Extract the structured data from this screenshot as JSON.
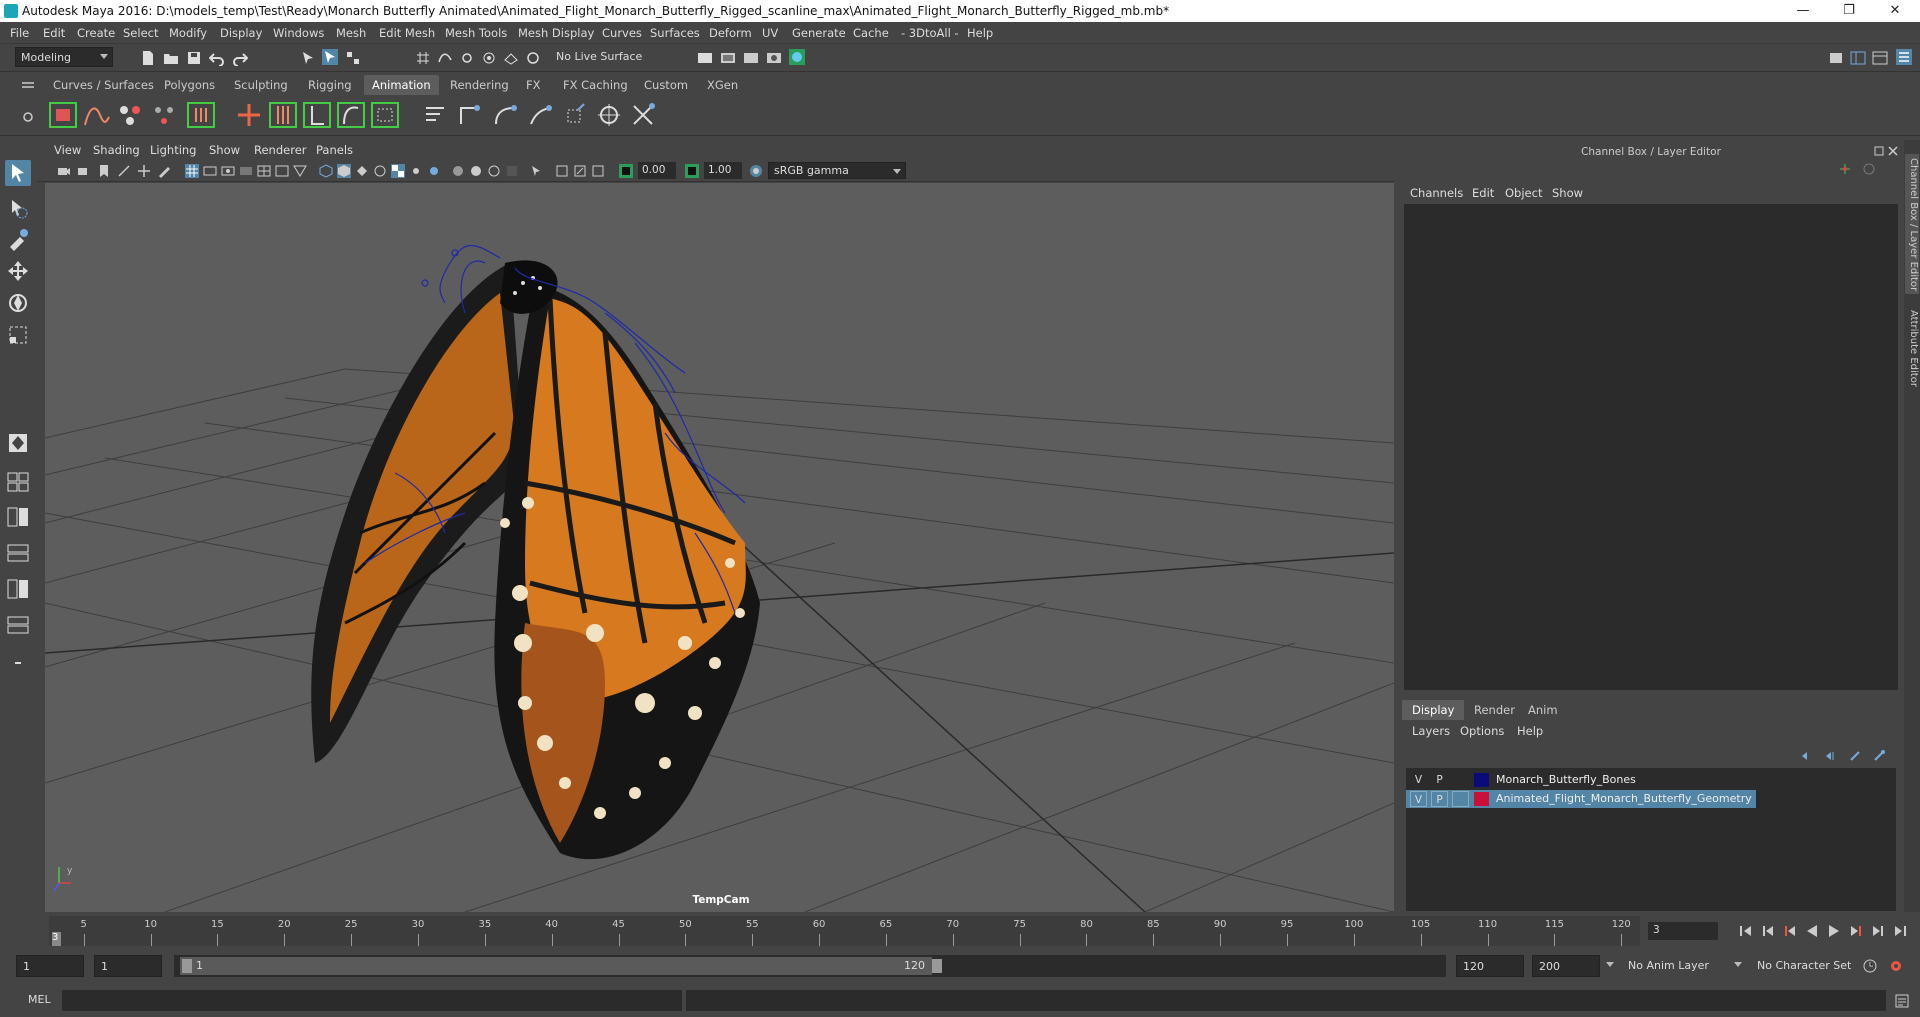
{
  "window": {
    "title": "Autodesk Maya 2016: D:\\models_temp\\Test\\Ready\\Monarch Butterfly Animated\\Animated_Flight_Monarch_Butterfly_Rigged_scanline_max\\Animated_Flight_Monarch_Butterfly_Rigged_mb.mb*",
    "minimize": "—",
    "restore": "❐",
    "close": "✕"
  },
  "menubar": [
    "File",
    "Edit",
    "Create",
    "Select",
    "Modify",
    "Display",
    "Windows",
    "Mesh",
    "Edit Mesh",
    "Mesh Tools",
    "Mesh Display",
    "Curves",
    "Surfaces",
    "Deform",
    "UV",
    "Generate",
    "Cache",
    "- 3DtoAll -",
    "Help"
  ],
  "statusline": {
    "mode": "Modeling",
    "live_surface": "No Live Surface"
  },
  "shelf_tabs": [
    "Curves / Surfaces",
    "Polygons",
    "Sculpting",
    "Rigging",
    "Animation",
    "Rendering",
    "FX",
    "FX Caching",
    "Custom",
    "XGen"
  ],
  "shelf_active": "Animation",
  "viewport": {
    "menu": [
      "View",
      "Shading",
      "Lighting",
      "Show",
      "Renderer",
      "Panels"
    ],
    "exposure": "0.00",
    "gamma": "1.00",
    "colorspace": "sRGB gamma",
    "camera": "TempCam"
  },
  "channelbox": {
    "header": "Channel Box / Layer Editor",
    "menu": [
      "Channels",
      "Edit",
      "Object",
      "Show"
    ]
  },
  "layer_editor": {
    "tabs": [
      "Display",
      "Render",
      "Anim"
    ],
    "active_tab": "Display",
    "menu": [
      "Layers",
      "Options",
      "Help"
    ],
    "layers": [
      {
        "v": "V",
        "p": "P",
        "color": "#0a0a7a",
        "name": "Monarch_Butterfly_Bones",
        "selected": false
      },
      {
        "v": "V",
        "p": "P",
        "color": "#c8103a",
        "name": "Animated_Flight_Monarch_Butterfly_Geometry",
        "selected": true
      }
    ]
  },
  "dock_tabs": [
    "Channel Box / Layer Editor",
    "Attribute Editor"
  ],
  "timeslider": {
    "ticks": [
      "5",
      "10",
      "15",
      "20",
      "25",
      "30",
      "35",
      "40",
      "45",
      "50",
      "55",
      "60",
      "65",
      "70",
      "75",
      "80",
      "85",
      "90",
      "95",
      "100",
      "105",
      "110",
      "115",
      "120"
    ],
    "current_marker": "3",
    "current_frame": "3"
  },
  "range": {
    "start": "1",
    "playback_start": "1",
    "slider_start": "1",
    "slider_end": "120",
    "playback_end": "120",
    "end": "200",
    "anim_layer": "No Anim Layer",
    "char_set": "No Character Set"
  },
  "cmdline": {
    "lang": "MEL"
  }
}
